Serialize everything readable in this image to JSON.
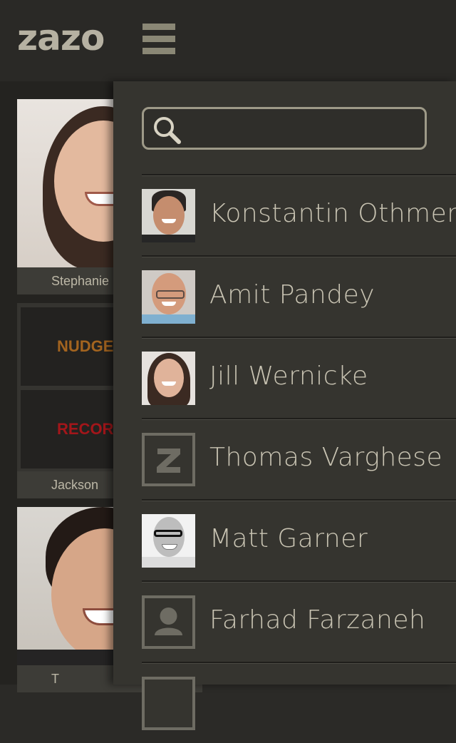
{
  "header": {
    "logo_text": "zazo",
    "menu_icon": "hamburger-icon"
  },
  "grid": {
    "tiles": [
      {
        "name": "Stephanie",
        "type": "photo"
      },
      {
        "name": "Jackson",
        "type": "actions",
        "nudge_label": "NUDGE",
        "record_label": "RECORD"
      },
      {
        "name": "T",
        "type": "photo"
      }
    ]
  },
  "drawer": {
    "search": {
      "placeholder": "",
      "value": "",
      "icon": "search-icon"
    },
    "contacts": [
      {
        "name": "Konstantin Othmer",
        "avatar": "photo"
      },
      {
        "name": "Amit Pandey",
        "avatar": "photo"
      },
      {
        "name": "Jill Wernicke",
        "avatar": "photo"
      },
      {
        "name": "Thomas Varghese",
        "avatar": "zazo-logo-icon"
      },
      {
        "name": "Matt Garner",
        "avatar": "photo"
      },
      {
        "name": "Farhad Farzaneh",
        "avatar": "person-placeholder-icon"
      }
    ]
  },
  "colors": {
    "background": "#2b2a27",
    "drawer": "#35342f",
    "text": "#c9c4b3",
    "nudge": "#a3641f",
    "record": "#a3161a",
    "accent": "#8a8775"
  }
}
